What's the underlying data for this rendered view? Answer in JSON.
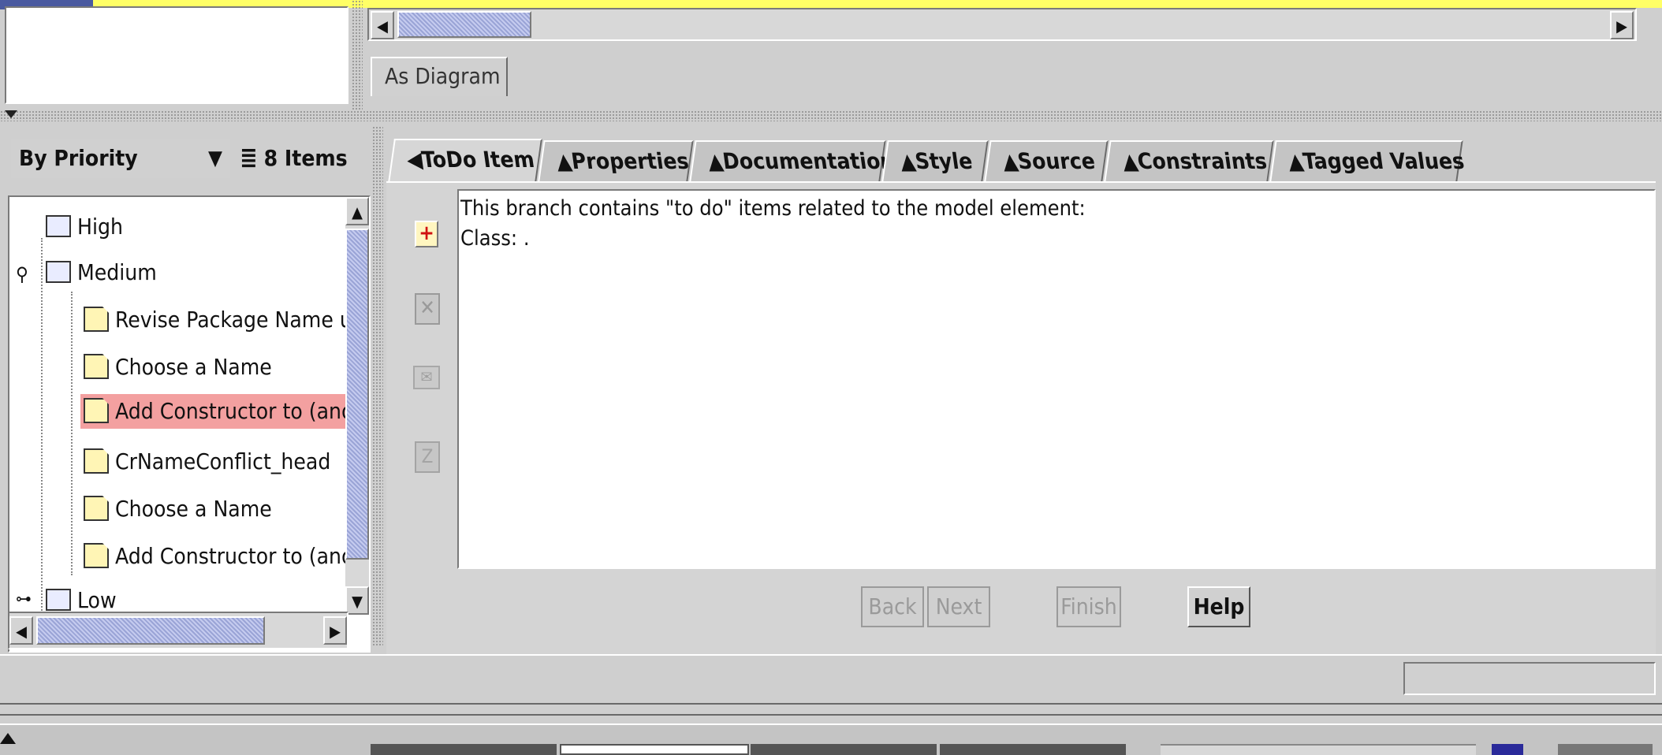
{
  "diagram_tab": "As Diagram",
  "todo_pane": {
    "sort_by": "By Priority",
    "items_count": "8 Items",
    "tree": [
      {
        "label": "High",
        "type": "folder"
      },
      {
        "label": "Medium",
        "type": "folder"
      },
      {
        "label": "Revise Package Name untit",
        "type": "item"
      },
      {
        "label": "Choose a Name",
        "type": "item"
      },
      {
        "label": "Add Constructor to (anon)",
        "type": "item",
        "selected": true
      },
      {
        "label": "CrNameConflict_head",
        "type": "item"
      },
      {
        "label": "Choose a Name",
        "type": "item"
      },
      {
        "label": "Add Constructor to (anon)",
        "type": "item"
      },
      {
        "label": "Low",
        "type": "folder"
      }
    ]
  },
  "details_tabs": [
    "ToDo Item",
    "Properties",
    "Documentation",
    "Style",
    "Source",
    "Constraints",
    "Tagged Values"
  ],
  "details_text": {
    "line1": "This branch contains \"to do\" items related to the model element:",
    "line2": "Class: ."
  },
  "wizard_buttons": {
    "back": "Back",
    "next": "Next",
    "finish": "Finish",
    "help": "Help"
  },
  "colors": {
    "accent_yellow": "#ffff66",
    "selection": "#f3a0a0",
    "scroll_thumb": "#a7b0e0"
  }
}
